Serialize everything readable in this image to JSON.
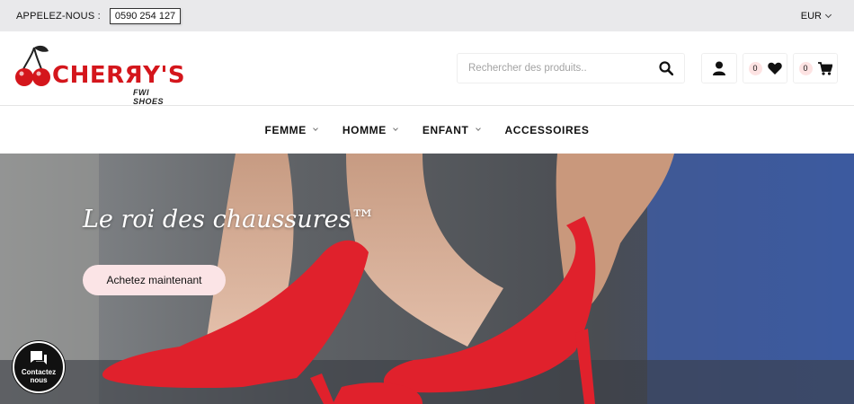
{
  "topbar": {
    "call_label": "APPELEZ-NOUS :",
    "phone": "0590 254 127",
    "currency": "EUR"
  },
  "header": {
    "logo_text": "CHERЯY'S",
    "logo_tagline": "FWI SHOES",
    "search_placeholder": "Rechercher des produits..",
    "wishlist_count": "0",
    "cart_count": "0"
  },
  "nav": {
    "items": [
      {
        "label": "FEMME"
      },
      {
        "label": "HOMME"
      },
      {
        "label": "ENFANT"
      },
      {
        "label": "ACCESSOIRES"
      }
    ]
  },
  "hero": {
    "title": "Le roi des chaussures™",
    "cta": "Achetez maintenant"
  },
  "chat": {
    "label_line1": "Contactez",
    "label_line2": "nous"
  },
  "colors": {
    "brand_red": "#d4161c",
    "topbar_bg": "#e9e9eb",
    "cta_bg": "#fbe4e6",
    "badge_bg": "#fde3e3"
  }
}
